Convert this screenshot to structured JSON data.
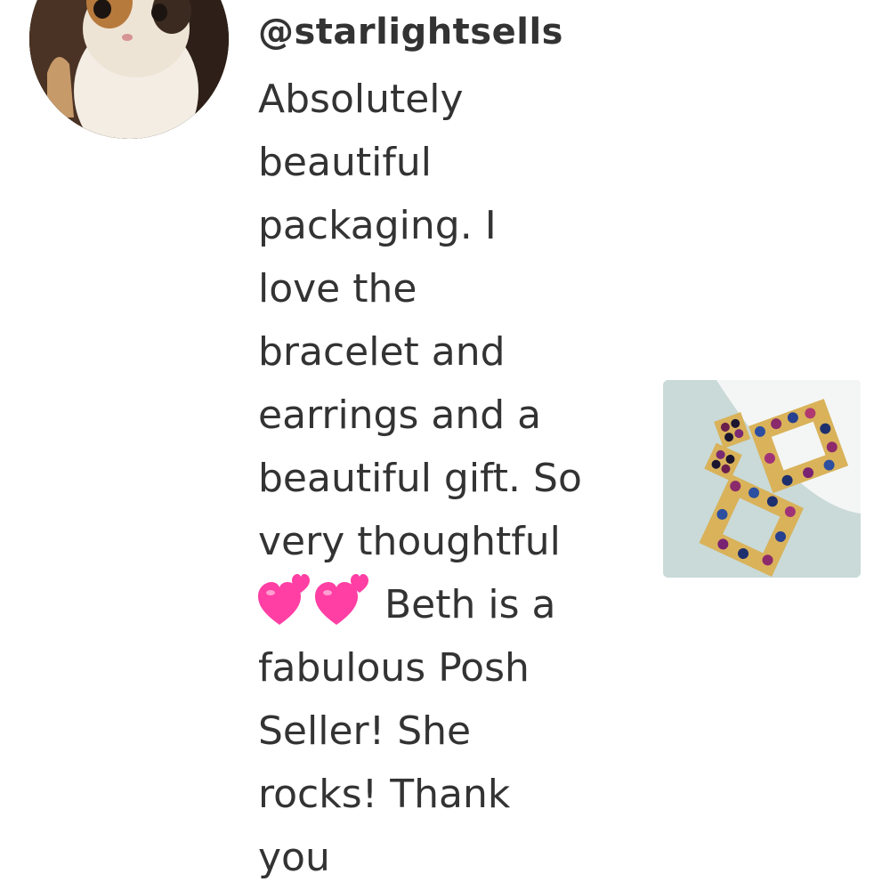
{
  "comment": {
    "username": "@starlightsells",
    "lines": [
      "Absolutely",
      "beautiful",
      "packaging. I",
      "love the",
      "bracelet and",
      "earrings and a",
      "beautiful gift. So",
      "very thoughtful",
      "Beth is a",
      "fabulous Posh",
      "Seller! She",
      "rocks! Thank",
      "you"
    ],
    "emoji_icon": "two-hearts-emoji"
  },
  "avatar": {
    "icon": "cat-avatar"
  },
  "product": {
    "icon": "jeweled-square-earrings-photo"
  },
  "colors": {
    "text": "#333333",
    "heart_pink": "#ff3fa4",
    "thumb_bg": "#c9dad8"
  }
}
